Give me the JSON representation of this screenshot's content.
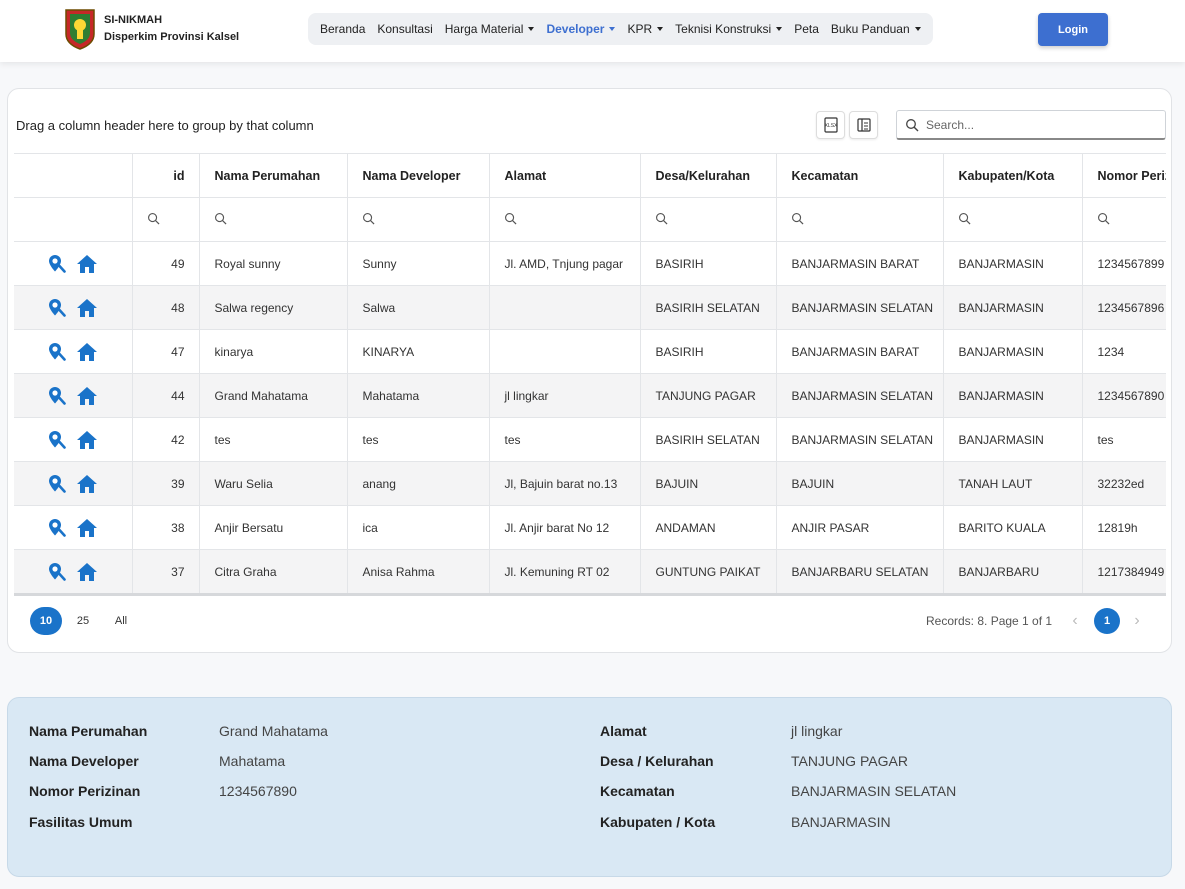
{
  "header": {
    "app_name": "SI-NIKMAH",
    "org_name": "Disperkim Provinsi Kalsel",
    "nav": [
      {
        "label": "Beranda",
        "dropdown": false,
        "active": false
      },
      {
        "label": "Konsultasi",
        "dropdown": false,
        "active": false
      },
      {
        "label": "Harga Material",
        "dropdown": true,
        "active": false
      },
      {
        "label": "Developer",
        "dropdown": true,
        "active": true
      },
      {
        "label": "KPR",
        "dropdown": true,
        "active": false
      },
      {
        "label": "Teknisi Konstruksi",
        "dropdown": true,
        "active": false
      },
      {
        "label": "Peta",
        "dropdown": false,
        "active": false
      },
      {
        "label": "Buku Panduan",
        "dropdown": true,
        "active": false
      }
    ],
    "login_label": "Login",
    "accent": "#3d6fd0"
  },
  "grid": {
    "group_hint": "Drag a column header here to group by that column",
    "export_excel_icon": "xlsx-export-icon",
    "column_chooser_icon": "column-chooser-icon",
    "search_placeholder": "Search...",
    "columns": [
      "",
      "id",
      "Nama Perumahan",
      "Nama Developer",
      "Alamat",
      "Desa/Kelurahan",
      "Kecamatan",
      "Kabupaten/Kota",
      "Nomor Perizinan"
    ],
    "rows": [
      {
        "id": "49",
        "nama_perumahan": "Royal sunny",
        "nama_developer": "Sunny",
        "alamat": "Jl. AMD, Tnjung pagar",
        "desa": "BASIRIH",
        "kecamatan": "BANJARMASIN BARAT",
        "kabupaten": "BANJARMASIN",
        "nomor": "1234567899"
      },
      {
        "id": "48",
        "nama_perumahan": "Salwa regency",
        "nama_developer": "Salwa",
        "alamat": "",
        "desa": "BASIRIH SELATAN",
        "kecamatan": "BANJARMASIN SELATAN",
        "kabupaten": "BANJARMASIN",
        "nomor": "1234567896"
      },
      {
        "id": "47",
        "nama_perumahan": "kinarya",
        "nama_developer": "KINARYA",
        "alamat": "",
        "desa": "BASIRIH",
        "kecamatan": "BANJARMASIN BARAT",
        "kabupaten": "BANJARMASIN",
        "nomor": "1234"
      },
      {
        "id": "44",
        "nama_perumahan": "Grand Mahatama",
        "nama_developer": "Mahatama",
        "alamat": "jl lingkar",
        "desa": "TANJUNG PAGAR",
        "kecamatan": "BANJARMASIN SELATAN",
        "kabupaten": "BANJARMASIN",
        "nomor": "1234567890"
      },
      {
        "id": "42",
        "nama_perumahan": "tes",
        "nama_developer": "tes",
        "alamat": "tes",
        "desa": "BASIRIH SELATAN",
        "kecamatan": "BANJARMASIN SELATAN",
        "kabupaten": "BANJARMASIN",
        "nomor": "tes"
      },
      {
        "id": "39",
        "nama_perumahan": "Waru Selia",
        "nama_developer": "anang",
        "alamat": "Jl, Bajuin barat no.13",
        "desa": "BAJUIN",
        "kecamatan": "BAJUIN",
        "kabupaten": "TANAH LAUT",
        "nomor": "32232ed"
      },
      {
        "id": "38",
        "nama_perumahan": "Anjir Bersatu",
        "nama_developer": "ica",
        "alamat": "Jl. Anjir barat No 12",
        "desa": "ANDAMAN",
        "kecamatan": "ANJIR PASAR",
        "kabupaten": "BARITO KUALA",
        "nomor": "12819h"
      },
      {
        "id": "37",
        "nama_perumahan": "Citra Graha",
        "nama_developer": "Anisa Rahma",
        "alamat": "Jl. Kemuning RT 02",
        "desa": "GUNTUNG PAIKAT",
        "kecamatan": "BANJARBARU SELATAN",
        "kabupaten": "BANJARBARU",
        "nomor": "1217384949"
      }
    ],
    "row_icons": [
      "location-search-icon",
      "home-icon"
    ],
    "pager": {
      "sizes": [
        "10",
        "25",
        "All"
      ],
      "active_size": "10",
      "records_text": "Records: 8. Page 1 of 1",
      "current_page": "1"
    }
  },
  "detail": {
    "left": [
      {
        "label": "Nama Perumahan",
        "value": "Grand Mahatama"
      },
      {
        "label": "Nama Developer",
        "value": "Mahatama"
      },
      {
        "label": "Nomor Perizinan",
        "value": "1234567890"
      },
      {
        "label": "Fasilitas Umum",
        "value": ""
      }
    ],
    "right": [
      {
        "label": "Alamat",
        "value": "jl lingkar"
      },
      {
        "label": "Desa / Kelurahan",
        "value": "TANJUNG PAGAR"
      },
      {
        "label": "Kecamatan",
        "value": "BANJARMASIN SELATAN"
      },
      {
        "label": "Kabupaten / Kota",
        "value": "BANJARMASIN"
      }
    ]
  }
}
